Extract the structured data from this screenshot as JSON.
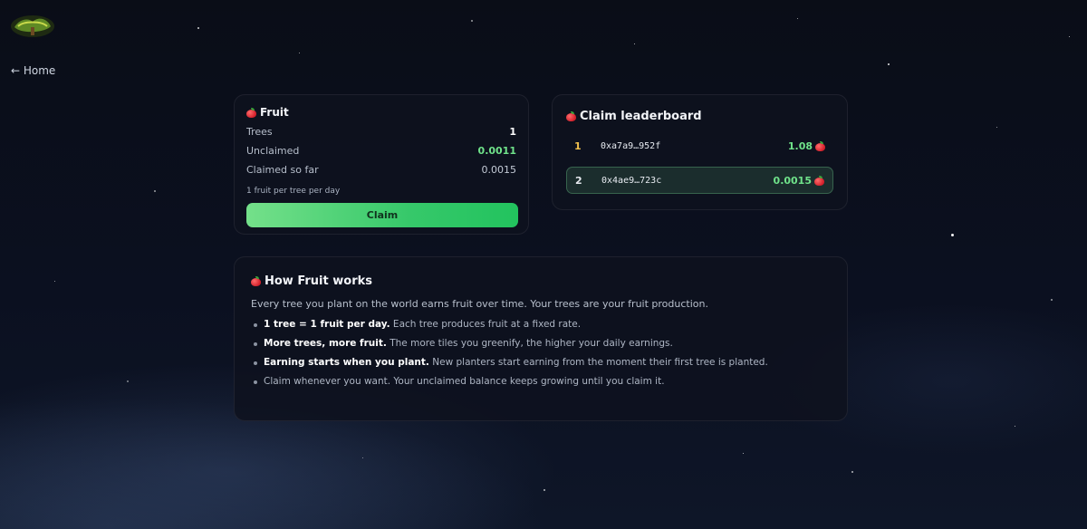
{
  "nav": {
    "home_label": "← Home",
    "logo_icon": "tree-logo-icon"
  },
  "fruit_card": {
    "title": "Fruit",
    "rows": [
      {
        "label": "Trees",
        "value": "1"
      },
      {
        "label": "Unclaimed",
        "value": "0.0011"
      },
      {
        "label": "Claimed so far",
        "value": "0.0015"
      }
    ],
    "note": "1 fruit per tree per day",
    "claim_label": "Claim"
  },
  "leaderboard": {
    "title": "Claim leaderboard",
    "entries": [
      {
        "rank": "1",
        "address": "0xa7a9…952f",
        "amount": "1.08"
      },
      {
        "rank": "2",
        "address": "0x4ae9…723c",
        "amount": "0.0015"
      }
    ]
  },
  "how": {
    "title": "How Fruit works",
    "intro": "Every tree you plant on the world earns fruit over time. Your trees are your fruit production.",
    "items": [
      {
        "bold": "1 tree = 1 fruit per day.",
        "text": " Each tree produces fruit at a fixed rate."
      },
      {
        "bold": "More trees, more fruit.",
        "text": " The more tiles you greenify, the higher your daily earnings."
      },
      {
        "bold": "Earning starts when you plant.",
        "text": " New planters start earning from the moment their first tree is planted."
      },
      {
        "bold": "",
        "text": "Claim whenever you want. Your unclaimed balance keeps growing until you claim it."
      }
    ]
  },
  "colors": {
    "accent_green": "#6fe28a",
    "rank_gold": "#f2c14e",
    "background": "#0a0d17"
  },
  "icons": {
    "fruit": "apple-icon"
  }
}
